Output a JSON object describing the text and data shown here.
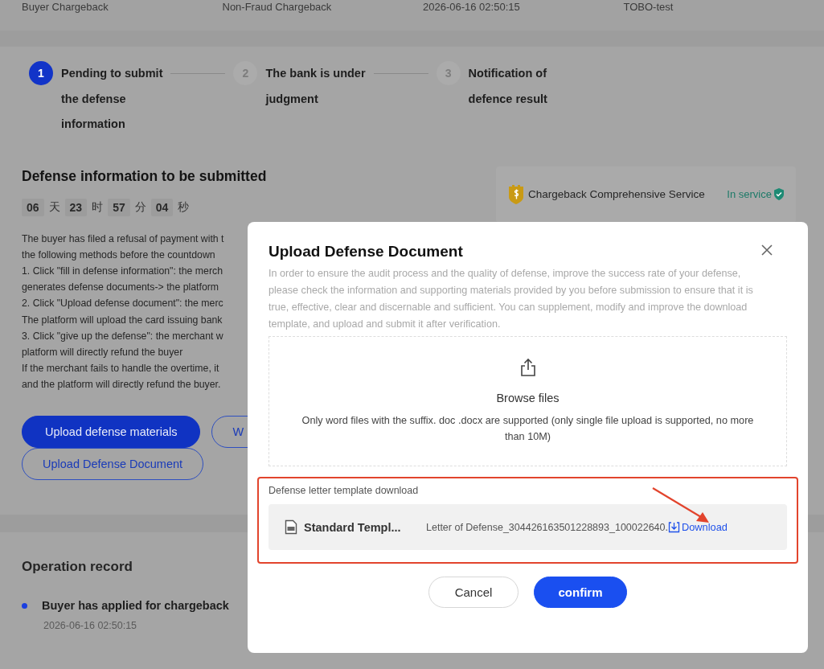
{
  "summary_row": [
    "Buyer Chargeback",
    "Non-Fraud Chargeback",
    "2026-06-16 02:50:15",
    "TOBO-test"
  ],
  "steps": [
    {
      "number": "1",
      "lines": [
        "Pending to submit",
        "the defense",
        "information"
      ],
      "selected": true
    },
    {
      "number": "2",
      "lines": [
        "The bank is under",
        "judgment"
      ],
      "selected": false
    },
    {
      "number": "3",
      "lines": [
        "Notification of",
        "defence result"
      ],
      "selected": false
    }
  ],
  "defense_section": {
    "title": "Defense information to be submitted",
    "countdown": [
      {
        "value": "06",
        "unit": "天"
      },
      {
        "value": "23",
        "unit": "时"
      },
      {
        "value": "57",
        "unit": "分"
      },
      {
        "value": "04",
        "unit": "秒"
      }
    ],
    "instructions": [
      "The buyer has filed a refusal of payment with t",
      "the following methods before the countdown",
      "1. Click \"fill in defense information\": the merch",
      "generates defense documents-> the platform",
      "2. Click \"Upload defense document\": the merc",
      "The platform will upload the card issuing bank",
      "3. Click \"give up the defense\": the merchant w",
      "platform will directly refund the buyer",
      "If the merchant fails to handle the overtime, it",
      "and the platform will directly refund the buyer."
    ],
    "buttons": [
      {
        "label": "Upload defense materials",
        "kind": "primary"
      },
      {
        "label": "W",
        "kind": "outline"
      },
      {
        "label": "Upload Defense Document",
        "kind": "outline"
      }
    ]
  },
  "service_card": {
    "name": "Chargeback Comprehensive Service",
    "status": "In service"
  },
  "operation_record": {
    "title": "Operation record",
    "items": [
      {
        "text": "Buyer has applied for chargeback",
        "time": "2026-06-16 02:50:15",
        "color": "#1a3fe0"
      }
    ]
  },
  "dialog": {
    "title": "Upload Defense Document",
    "description": "In order to ensure the audit process and the quality of defense, improve the success rate of your defense, please check the information and supporting materials provided by you before submission to ensure that it is true, effective, clear and discernable and sufficient. You can supplement, modify and improve the download template, and upload and submit it after verification.",
    "upload": {
      "label": "Browse files",
      "hint": "Only word files with the suffix. doc .docx are supported (only single file upload is supported, no more than 10M)"
    },
    "template": {
      "heading": "Defense letter template download",
      "highlighted": true,
      "name": "Standard Templ...",
      "file": "Letter of Defense_304426163501228893_100022640.",
      "action": "Download"
    },
    "buttons": [
      {
        "label": "Cancel",
        "kind": "secondary"
      },
      {
        "label": "confirm",
        "kind": "primary"
      }
    ]
  }
}
